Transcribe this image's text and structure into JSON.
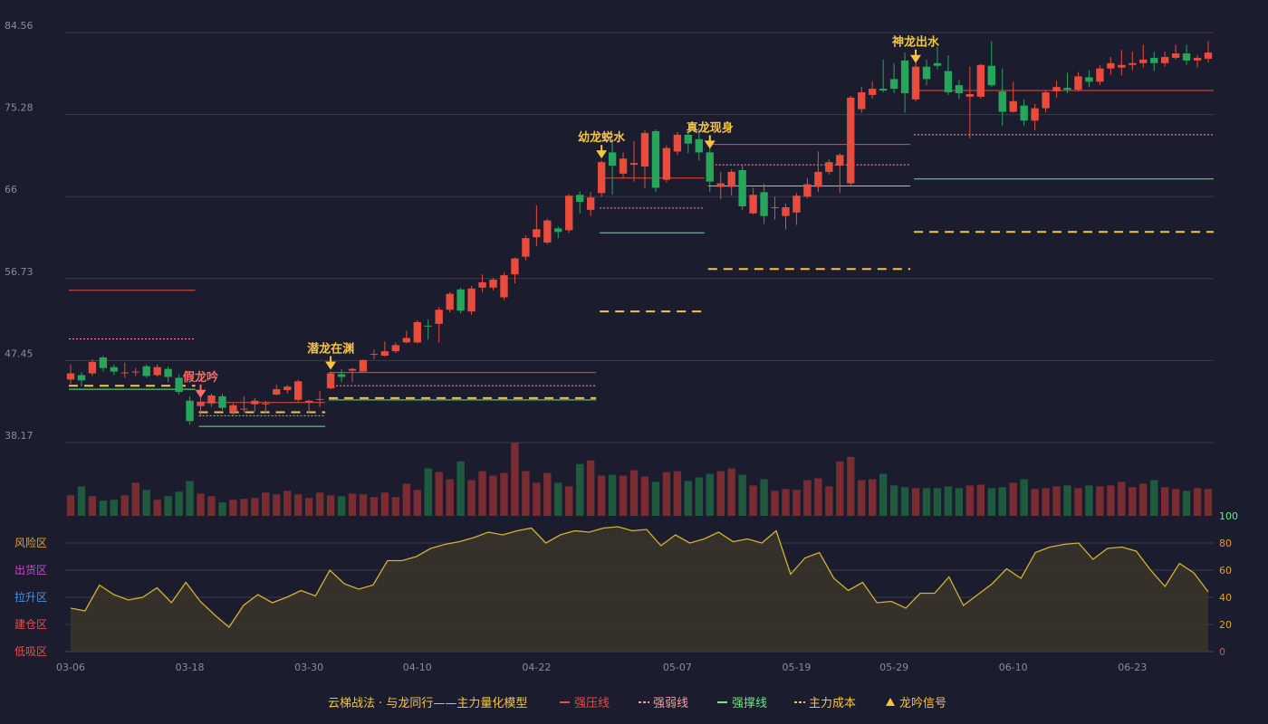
{
  "chart_data": {
    "type": "candlestick",
    "title": "",
    "price_axis": {
      "ticks": [
        38.17,
        47.45,
        56.73,
        66.0,
        75.28,
        84.56
      ],
      "ylim": [
        38.17,
        84.56
      ]
    },
    "dates": [
      "03-06",
      "03-07",
      "03-08",
      "03-09",
      "03-10",
      "03-11",
      "03-12",
      "03-13",
      "03-14",
      "03-15",
      "03-16",
      "03-18",
      "03-19",
      "03-20",
      "03-21",
      "03-22",
      "03-23",
      "03-24",
      "03-25",
      "03-26",
      "03-27",
      "03-28",
      "03-30",
      "03-31",
      "04-01",
      "04-02",
      "04-03",
      "04-04",
      "04-05",
      "04-06",
      "04-07",
      "04-08",
      "04-10",
      "04-11",
      "04-12",
      "04-13",
      "04-14",
      "04-15",
      "04-16",
      "04-17",
      "04-18",
      "04-19",
      "04-21",
      "04-22",
      "04-23",
      "04-24",
      "04-25",
      "04-26",
      "04-27",
      "04-28",
      "04-29",
      "05-01",
      "05-02",
      "05-03",
      "05-04",
      "05-05",
      "05-07",
      "05-08",
      "05-09",
      "05-10",
      "05-11",
      "05-12",
      "05-13",
      "05-14",
      "05-15",
      "05-16",
      "05-17",
      "05-19",
      "05-20",
      "05-21",
      "05-22",
      "05-23",
      "05-24",
      "05-25",
      "05-26",
      "05-27",
      "05-29",
      "05-30",
      "05-31",
      "06-01",
      "06-02",
      "06-03",
      "06-04",
      "06-05",
      "06-06",
      "06-07",
      "06-08",
      "06-10",
      "06-11",
      "06-12",
      "06-13",
      "06-14",
      "06-15",
      "06-16",
      "06-17",
      "06-18",
      "06-19",
      "06-20",
      "06-23",
      "06-24",
      "06-25",
      "06-26",
      "06-27",
      "06-28",
      "06-29",
      "06-30"
    ],
    "x_ticks": [
      "03-06",
      "03-18",
      "03-30",
      "04-10",
      "04-22",
      "05-07",
      "05-19",
      "05-29",
      "06-10",
      "06-23"
    ],
    "candles": [
      [
        45.3,
        46.0,
        47.0,
        44.8
      ],
      [
        45.8,
        45.2,
        46.1,
        44.5
      ],
      [
        46.0,
        47.3,
        47.6,
        45.7
      ],
      [
        47.8,
        46.6,
        48.0,
        46.2
      ],
      [
        46.7,
        46.2,
        47.0,
        45.8
      ],
      [
        46.0,
        46.1,
        47.2,
        45.5
      ],
      [
        46.1,
        46.2,
        46.6,
        45.7
      ],
      [
        46.8,
        45.7,
        47.0,
        45.5
      ],
      [
        45.8,
        46.7,
        47.0,
        45.6
      ],
      [
        46.5,
        45.6,
        46.8,
        45.0
      ],
      [
        45.5,
        43.9,
        45.9,
        43.6
      ],
      [
        42.9,
        40.6,
        43.4,
        40.2
      ],
      [
        42.3,
        42.8,
        43.4,
        41.1
      ],
      [
        42.6,
        43.5,
        43.7,
        42.2
      ],
      [
        43.4,
        42.1,
        43.7,
        41.8
      ],
      [
        41.6,
        42.4,
        42.6,
        41.2
      ],
      [
        42.0,
        42.0,
        43.4,
        41.6
      ],
      [
        42.5,
        42.9,
        43.2,
        41.7
      ],
      [
        42.6,
        42.6,
        42.9,
        41.5
      ],
      [
        43.6,
        44.2,
        44.7,
        43.5
      ],
      [
        44.1,
        44.5,
        44.7,
        43.7
      ],
      [
        43.0,
        45.1,
        45.3,
        42.7
      ],
      [
        42.7,
        42.9,
        43.0,
        41.5
      ],
      [
        43.0,
        43.1,
        44.0,
        42.2
      ],
      [
        44.3,
        46.0,
        46.2,
        44.2
      ],
      [
        45.9,
        45.6,
        46.5,
        45.0
      ],
      [
        46.3,
        46.5,
        46.6,
        45.0
      ],
      [
        46.2,
        47.5,
        47.6,
        46.2
      ],
      [
        48.1,
        48.2,
        48.7,
        47.6
      ],
      [
        48.0,
        48.5,
        49.6,
        47.9
      ],
      [
        48.5,
        49.2,
        49.5,
        48.3
      ],
      [
        49.5,
        50.0,
        50.8,
        49.4
      ],
      [
        49.5,
        51.8,
        52.0,
        49.4
      ],
      [
        51.4,
        51.3,
        52.1,
        49.8
      ],
      [
        51.6,
        53.2,
        53.5,
        49.5
      ],
      [
        53.2,
        55.0,
        55.2,
        52.9
      ],
      [
        55.5,
        53.1,
        55.7,
        52.8
      ],
      [
        53.0,
        55.6,
        55.9,
        52.6
      ],
      [
        55.7,
        56.3,
        57.2,
        55.2
      ],
      [
        55.7,
        56.6,
        56.8,
        55.4
      ],
      [
        54.6,
        57.1,
        57.4,
        54.3
      ],
      [
        57.2,
        59.0,
        59.1,
        56.2
      ],
      [
        59.2,
        61.3,
        61.6,
        58.8
      ],
      [
        61.4,
        62.3,
        65.0,
        60.4
      ],
      [
        60.8,
        63.3,
        63.5,
        60.6
      ],
      [
        62.4,
        62.0,
        62.6,
        61.3
      ],
      [
        62.2,
        66.1,
        66.3,
        61.9
      ],
      [
        66.2,
        65.4,
        66.6,
        64.1
      ],
      [
        64.5,
        65.9,
        66.5,
        63.8
      ],
      [
        66.4,
        69.9,
        70.1,
        66.0
      ],
      [
        71.0,
        69.5,
        72.5,
        66.2
      ],
      [
        68.6,
        70.3,
        71.0,
        68.1
      ],
      [
        69.6,
        69.8,
        72.3,
        67.7
      ],
      [
        69.4,
        73.2,
        73.5,
        66.9
      ],
      [
        73.4,
        67.0,
        73.6,
        66.5
      ],
      [
        67.9,
        71.5,
        71.8,
        67.6
      ],
      [
        71.1,
        73.0,
        73.3,
        70.7
      ],
      [
        73.0,
        72.0,
        73.3,
        70.9
      ],
      [
        72.5,
        71.0,
        73.8,
        70.1
      ],
      [
        71.0,
        67.7,
        72.2,
        66.5
      ],
      [
        67.1,
        67.5,
        68.8,
        65.7
      ],
      [
        67.1,
        68.8,
        69.1,
        66.1
      ],
      [
        69.0,
        64.9,
        69.5,
        64.5
      ],
      [
        64.1,
        66.2,
        67.0,
        64.0
      ],
      [
        66.5,
        63.8,
        67.5,
        62.9
      ],
      [
        64.8,
        64.8,
        66.0,
        63.4
      ],
      [
        63.8,
        64.8,
        65.2,
        62.3
      ],
      [
        64.2,
        66.1,
        66.4,
        62.8
      ],
      [
        66.0,
        67.4,
        68.1,
        65.8
      ],
      [
        67.1,
        68.8,
        71.1,
        66.5
      ],
      [
        68.8,
        69.9,
        70.2,
        68.5
      ],
      [
        69.5,
        70.7,
        70.9,
        66.4
      ],
      [
        67.5,
        77.2,
        77.4,
        67.2
      ],
      [
        75.9,
        77.8,
        78.4,
        75.5
      ],
      [
        77.5,
        78.2,
        79.0,
        77.1
      ],
      [
        78.2,
        78.0,
        81.5,
        77.8
      ],
      [
        79.3,
        78.2,
        81.1,
        77.7
      ],
      [
        81.4,
        77.7,
        82.3,
        75.5
      ],
      [
        77.0,
        80.7,
        82.4,
        76.8
      ],
      [
        80.7,
        79.3,
        81.5,
        78.6
      ],
      [
        81.1,
        80.8,
        83.0,
        80.4
      ],
      [
        80.2,
        77.8,
        82.0,
        77.5
      ],
      [
        78.6,
        77.7,
        79.2,
        77.0
      ],
      [
        77.3,
        77.6,
        80.7,
        72.6
      ],
      [
        77.3,
        80.9,
        81.0,
        77.1
      ],
      [
        80.8,
        78.6,
        83.6,
        78.4
      ],
      [
        77.9,
        75.6,
        80.5,
        74.0
      ],
      [
        75.6,
        76.8,
        79.0,
        75.5
      ],
      [
        76.3,
        74.6,
        77.0,
        74.0
      ],
      [
        74.6,
        76.0,
        76.5,
        73.5
      ],
      [
        76.0,
        77.8,
        78.0,
        75.5
      ],
      [
        77.9,
        78.4,
        79.1,
        77.2
      ],
      [
        78.3,
        78.1,
        80.0,
        77.7
      ],
      [
        78.1,
        79.6,
        80.1,
        77.9
      ],
      [
        79.5,
        79.0,
        80.3,
        78.4
      ],
      [
        79.0,
        80.5,
        80.9,
        78.6
      ],
      [
        80.5,
        81.1,
        81.8,
        79.8
      ],
      [
        80.6,
        80.9,
        82.6,
        79.7
      ],
      [
        80.9,
        81.1,
        82.4,
        80.3
      ],
      [
        81.1,
        81.5,
        83.2,
        80.6
      ],
      [
        81.7,
        81.1,
        82.4,
        80.2
      ],
      [
        81.1,
        81.8,
        82.4,
        80.7
      ],
      [
        81.7,
        82.2,
        83.2,
        81.5
      ],
      [
        82.2,
        81.4,
        83.2,
        80.9
      ],
      [
        81.4,
        81.7,
        82.0,
        80.6
      ],
      [
        81.6,
        82.3,
        83.6,
        81.2
      ]
    ],
    "volume": [
      23,
      33,
      22,
      17,
      18,
      23,
      37,
      29,
      18,
      22,
      27,
      39,
      25,
      22,
      15,
      18,
      19,
      20,
      26,
      24,
      28,
      24,
      20,
      26,
      23,
      22,
      25,
      24,
      21,
      26,
      21,
      36,
      29,
      53,
      49,
      41,
      61,
      40,
      50,
      45,
      48,
      82,
      50,
      37,
      48,
      37,
      33,
      58,
      62,
      45,
      46,
      45,
      51,
      44,
      38,
      49,
      50,
      39,
      43,
      47,
      50,
      53,
      46,
      34,
      41,
      28,
      30,
      29,
      40,
      42,
      33,
      61,
      66,
      40,
      41,
      47,
      34,
      32,
      31,
      31,
      31,
      33,
      31,
      34,
      35,
      31,
      32,
      37,
      41,
      30,
      31,
      33,
      34,
      31,
      34,
      33,
      34,
      38,
      32,
      36,
      40,
      32,
      30,
      28,
      31,
      30
    ],
    "oscillator": [
      32,
      30,
      49,
      42,
      38,
      40,
      47,
      36,
      51,
      37,
      27,
      18,
      34,
      42,
      36,
      40,
      45,
      41,
      60,
      50,
      46,
      49,
      67,
      67,
      70,
      76,
      79,
      81,
      84,
      88,
      86,
      89,
      91,
      80,
      86,
      89,
      88,
      91,
      92,
      89,
      90,
      78,
      86,
      80,
      83,
      88,
      81,
      83,
      80,
      89,
      57,
      69,
      73,
      54,
      45,
      51,
      36,
      37,
      32,
      43,
      43,
      55,
      34,
      42,
      50,
      61,
      54,
      73,
      77,
      79,
      80,
      68,
      76,
      77,
      74,
      60,
      48,
      65,
      58,
      44
    ],
    "oscillator_axis": {
      "ticks": [
        0,
        20,
        40,
        60,
        80,
        100
      ],
      "ylim": [
        0,
        100
      ]
    },
    "zones": [
      {
        "label": "风险区",
        "color": "#e6a020"
      },
      {
        "label": "出货区",
        "color": "#d040d0"
      },
      {
        "label": "拉升区",
        "color": "#4c8ee0"
      },
      {
        "label": "建仓区",
        "color": "#e05050"
      },
      {
        "label": "低吸区",
        "color": "#e05050"
      }
    ],
    "overlays": [
      {
        "from": 0,
        "to": 12,
        "strong_pressure": 55.4,
        "strong_weak": 49.9,
        "strong_support": 44.2,
        "main_cost": 44.6
      },
      {
        "from": 12,
        "to": 24,
        "strong_pressure": 42.7,
        "strong_weak": 41.2,
        "strong_support": 40.0,
        "main_cost": 41.6
      },
      {
        "from": 24,
        "to": 49,
        "strong_pressure": 46.1,
        "strong_weak": 44.6,
        "strong_support": 43.0,
        "main_cost": 43.2
      },
      {
        "from": 49,
        "to": 59,
        "strong_pressure": 68.1,
        "strong_weak": 64.7,
        "strong_support": 61.9,
        "main_cost": 53.0
      },
      {
        "from": 59,
        "to": 78,
        "strong_pressure": 71.9,
        "strong_weak": 69.6,
        "strong_support": 67.2,
        "main_cost": 57.8
      },
      {
        "from": 78,
        "to": 106,
        "strong_pressure": 78.0,
        "strong_weak": 73.0,
        "strong_support": 68.0,
        "main_cost": 62.0
      }
    ],
    "signals": [
      {
        "index": 12,
        "label": "假龙吟",
        "color": "#ff6b6b",
        "kind": "false"
      },
      {
        "index": 24,
        "label": "潜龙在渊",
        "color": "#f5c542",
        "kind": "true"
      },
      {
        "index": 49,
        "label": "幼龙蜕水",
        "color": "#f5c542",
        "kind": "true"
      },
      {
        "index": 59,
        "label": "真龙现身",
        "color": "#f5c542",
        "kind": "true"
      },
      {
        "index": 78,
        "label": "神龙出水",
        "color": "#f5c542",
        "kind": "true"
      }
    ],
    "colors": {
      "up": "#e74c3c",
      "down": "#26a65b",
      "up_dim": "#7a2c33",
      "down_dim": "#1f5a3f",
      "grid": "#3a3b4f",
      "axis_text": "#8a8b9a",
      "oscillator_line": "#d4b32c",
      "oscillator_fill": "#3a3428"
    },
    "legend": [
      {
        "label": "云梯战法 · 与龙同行——主力量化模型",
        "color": "#f5c542",
        "marker": "none"
      },
      {
        "label": "强压线",
        "color": "#e74c3c",
        "marker": "solid"
      },
      {
        "label": "强弱线",
        "color": "#ff9a9a",
        "marker": "dashed"
      },
      {
        "label": "强撑线",
        "color": "#5cf07a",
        "marker": "solid"
      },
      {
        "label": "主力成本",
        "color": "#f5c542",
        "marker": "dashed"
      },
      {
        "label": "龙吟信号",
        "color": "#f5c542",
        "marker": "triangle"
      }
    ]
  }
}
